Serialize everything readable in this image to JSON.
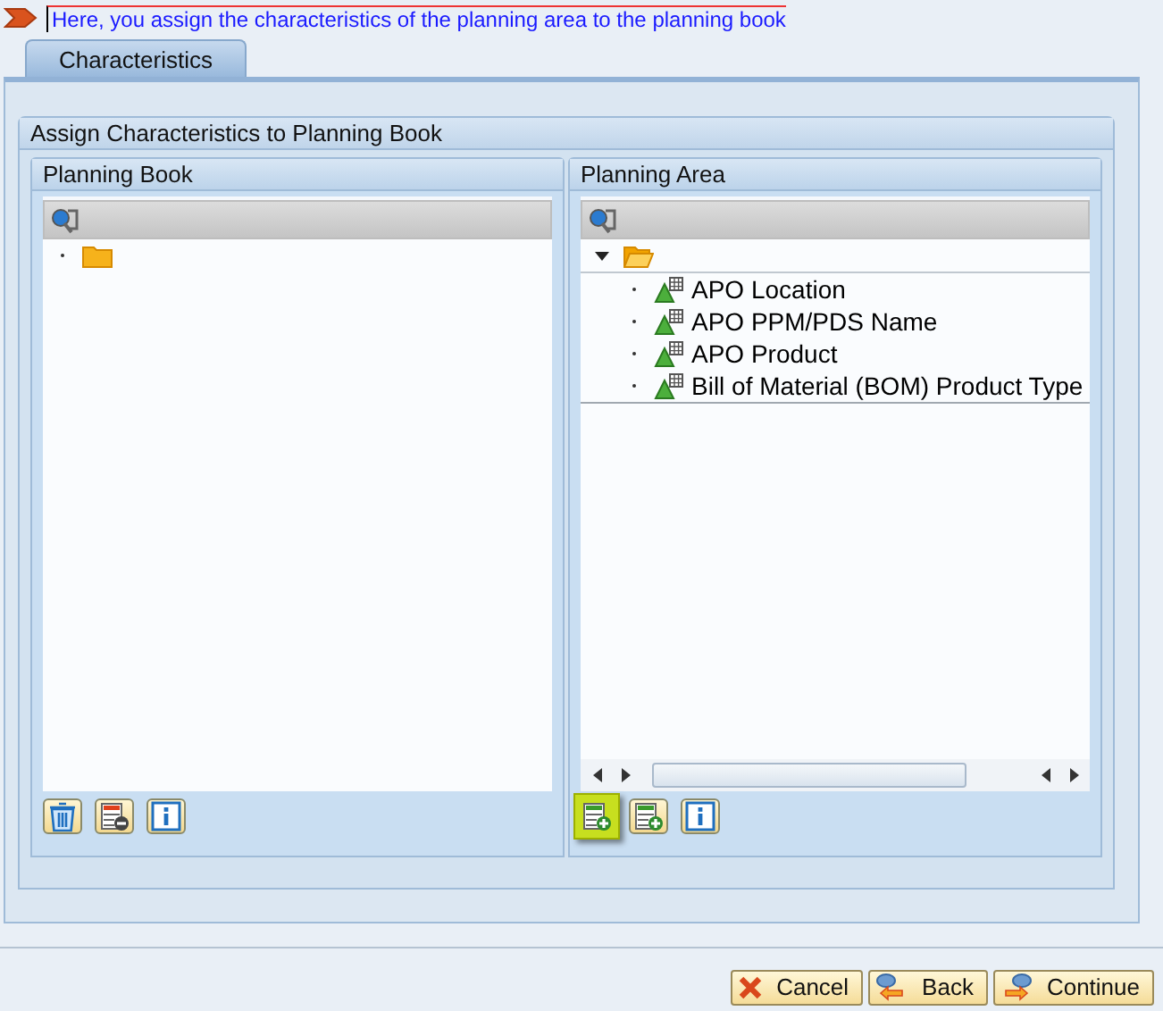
{
  "hint": {
    "text": "Here, you assign the characteristics of the planning area to the planning book"
  },
  "tabs": [
    {
      "label": "Characteristics",
      "selected": true
    }
  ],
  "group": {
    "title": "Assign Characteristics to Planning Book"
  },
  "panes": [
    {
      "title": "Planning Book",
      "tree": {
        "expanded": false
      },
      "scrollbar": false,
      "buttons": [
        {
          "kind": "delete",
          "highlighted": false
        },
        {
          "kind": "remove",
          "highlighted": false
        },
        {
          "kind": "info",
          "highlighted": false
        }
      ]
    },
    {
      "title": "Planning Area",
      "tree": {
        "expanded": true,
        "children": [
          {
            "label": "APO Location"
          },
          {
            "label": "APO PPM/PDS Name"
          },
          {
            "label": "APO Product"
          },
          {
            "label": "Bill of Material (BOM) Product Type"
          }
        ]
      },
      "scrollbar": true,
      "buttons": [
        {
          "kind": "add",
          "highlighted": true
        },
        {
          "kind": "add",
          "highlighted": false
        },
        {
          "kind": "info",
          "highlighted": false
        }
      ]
    }
  ],
  "footer": [
    {
      "kind": "cancel",
      "label": "Cancel"
    },
    {
      "kind": "back",
      "label": "Back"
    },
    {
      "kind": "continue",
      "label": "Continue"
    }
  ]
}
